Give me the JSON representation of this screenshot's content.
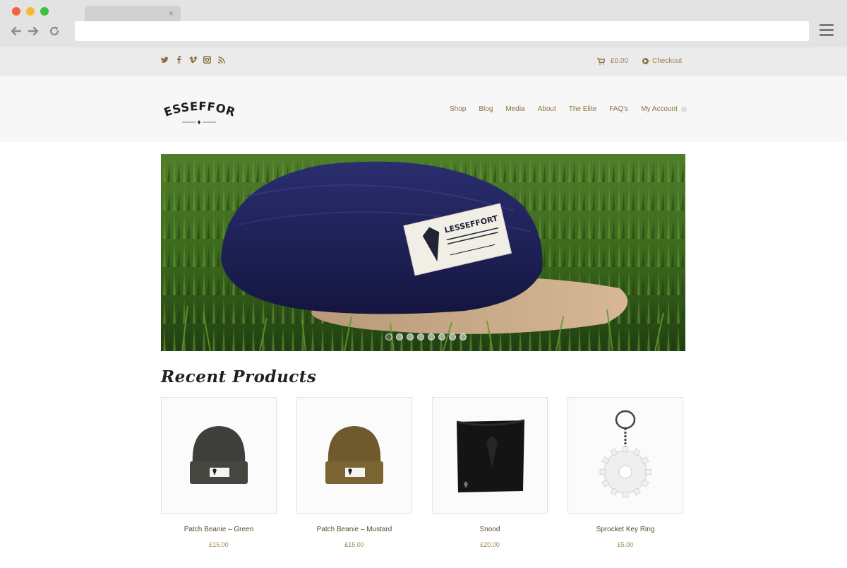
{
  "browser": {
    "tab_close_glyph": "×",
    "url": ""
  },
  "topbar": {
    "social_icons": [
      "twitter-icon",
      "facebook-icon",
      "vimeo-icon",
      "instagram-icon",
      "rss-icon"
    ],
    "cart_total": "£0.00",
    "checkout_label": "Checkout"
  },
  "header": {
    "logo_text": "LESSEFFORT",
    "nav": [
      "Shop",
      "Blog",
      "Media",
      "About",
      "The Elite",
      "FAQ's",
      "My Account"
    ]
  },
  "hero": {
    "slide_count": 8,
    "active_slide": 1,
    "patch_brand": "LESSEFFORT"
  },
  "recent": {
    "title": "Recent Products",
    "products": [
      {
        "name": "Patch Beanie – Green",
        "price": "£15.00"
      },
      {
        "name": "Patch Beanie – Mustard",
        "price": "£15.00"
      },
      {
        "name": "Snood",
        "price": "£20.00"
      },
      {
        "name": "Sprocket Key Ring",
        "price": "£5.00"
      }
    ]
  },
  "colors": {
    "accent": "#8a7440",
    "chrome": "#e3e3e3",
    "topbar": "#ebebeb",
    "header": "#f7f7f7"
  }
}
